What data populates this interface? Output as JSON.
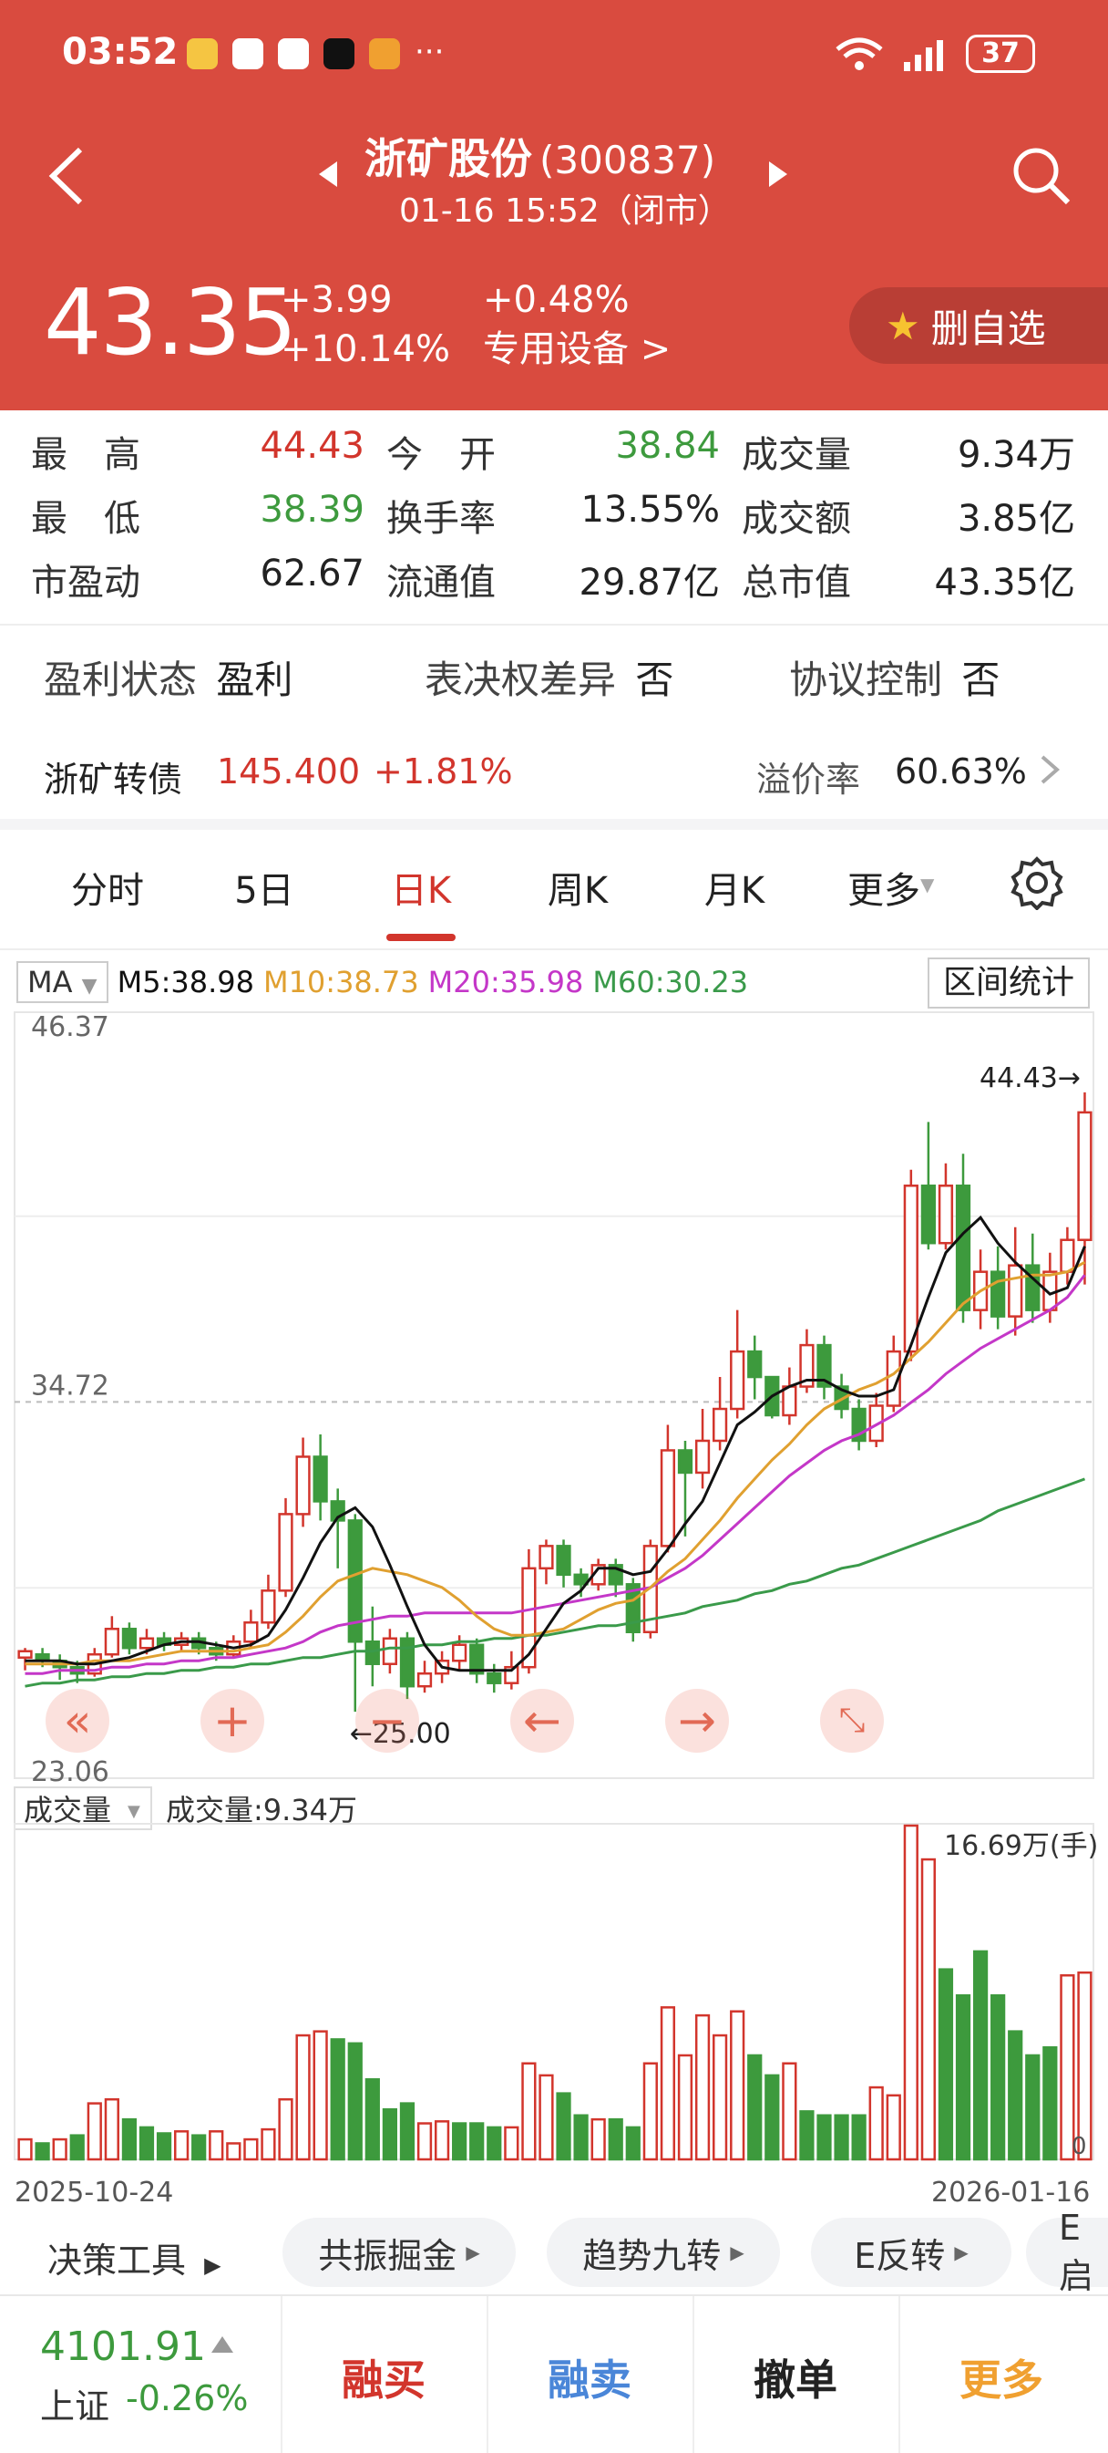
{
  "status_bar": {
    "time": "03:52",
    "dots": "···",
    "battery": "37"
  },
  "header": {
    "back_icon": "back-arrow-icon",
    "stock_name": "浙矿股份",
    "stock_code": "(300837)",
    "datetime": "01-16 15:52（闭市）",
    "price": "43.35",
    "change": "+3.99",
    "change_pct": "+10.14%",
    "other_pct": "+0.48%",
    "sector": "专用设备 >",
    "fav_button": "删自选"
  },
  "stats": [
    [
      {
        "label": "最　高",
        "value": "44.43",
        "color": "red"
      },
      {
        "label": "今　开",
        "value": "38.84",
        "color": "green"
      },
      {
        "label": "成交量",
        "value": "9.34万",
        "color": "dark"
      }
    ],
    [
      {
        "label": "最　低",
        "value": "38.39",
        "color": "green"
      },
      {
        "label": "换手率",
        "value": "13.55%",
        "color": "dark"
      },
      {
        "label": "成交额",
        "value": "3.85亿",
        "color": "dark"
      }
    ],
    [
      {
        "label": "市盈动",
        "value": "62.67",
        "color": "dark"
      },
      {
        "label": "流通值",
        "value": "29.87亿",
        "color": "dark"
      },
      {
        "label": "总市值",
        "value": "43.35亿",
        "color": "dark"
      }
    ]
  ],
  "tags": {
    "profit_label": "盈利状态",
    "profit_value": "盈利",
    "vote_label": "表决权差异",
    "vote_value": "否",
    "agree_label": "协议控制",
    "agree_value": "否"
  },
  "bond": {
    "name": "浙矿转债",
    "price": "145.400",
    "change": "+1.81%",
    "premium_label": "溢价率",
    "premium_value": "60.63%"
  },
  "tabs": [
    "分时",
    "5日",
    "日K",
    "周K",
    "月K",
    "更多"
  ],
  "active_tab": "日K",
  "ma_bar": {
    "selector": "MA",
    "m5": "M5:38.98",
    "m10": "M10:38.73",
    "m20": "M20:35.98",
    "m60": "M60:30.23",
    "stats_button": "区间统计"
  },
  "colors": {
    "up": "#d2352c",
    "down": "#3d9a3d",
    "m5": "#111111",
    "m10": "#e0a030",
    "m20": "#c437c8",
    "m60": "#3a9a4a",
    "header": "#d94b3f"
  },
  "chart_data": {
    "type": "candlestick",
    "y_top_label": "46.37",
    "y_mid_label": "34.72",
    "y_bottom_label": "23.06",
    "ylim": [
      23.06,
      46.37
    ],
    "high_marker": "44.43→",
    "low_marker": "←25.00",
    "x_start": "2025-10-24",
    "x_end": "2026-01-16",
    "candles": [
      [
        26.7,
        26.9,
        26.3,
        27.0
      ],
      [
        26.8,
        26.6,
        26.4,
        27.0
      ],
      [
        26.6,
        26.4,
        26.0,
        26.8
      ],
      [
        26.4,
        26.2,
        25.9,
        26.6
      ],
      [
        26.2,
        26.8,
        26.1,
        27.0
      ],
      [
        26.8,
        27.6,
        26.7,
        28.0
      ],
      [
        27.6,
        27.0,
        26.8,
        27.8
      ],
      [
        27.0,
        27.3,
        26.8,
        27.6
      ],
      [
        27.3,
        27.1,
        26.9,
        27.5
      ],
      [
        27.1,
        27.3,
        26.9,
        27.5
      ],
      [
        27.3,
        27.0,
        26.8,
        27.5
      ],
      [
        27.0,
        26.8,
        26.6,
        27.2
      ],
      [
        26.8,
        27.2,
        26.7,
        27.4
      ],
      [
        27.2,
        27.8,
        27.0,
        28.2
      ],
      [
        27.8,
        28.8,
        27.6,
        29.3
      ],
      [
        28.8,
        31.2,
        28.6,
        31.7
      ],
      [
        31.2,
        33.0,
        30.8,
        33.6
      ],
      [
        33.0,
        31.6,
        31.0,
        33.7
      ],
      [
        31.6,
        31.0,
        29.5,
        32.0
      ],
      [
        31.0,
        27.2,
        25.0,
        31.2
      ],
      [
        27.2,
        26.5,
        25.8,
        28.3
      ],
      [
        26.5,
        27.3,
        26.2,
        27.6
      ],
      [
        27.3,
        25.8,
        25.4,
        27.5
      ],
      [
        25.8,
        26.2,
        25.6,
        26.6
      ],
      [
        26.2,
        26.6,
        25.9,
        26.9
      ],
      [
        26.6,
        27.1,
        26.3,
        27.4
      ],
      [
        27.1,
        26.2,
        25.9,
        27.3
      ],
      [
        26.2,
        25.9,
        25.6,
        26.5
      ],
      [
        25.9,
        26.4,
        25.7,
        26.9
      ],
      [
        26.4,
        29.5,
        26.2,
        30.1
      ],
      [
        29.5,
        30.2,
        29.0,
        30.4
      ],
      [
        30.2,
        29.3,
        28.9,
        30.4
      ],
      [
        29.3,
        29.0,
        28.6,
        29.5
      ],
      [
        29.0,
        29.6,
        28.8,
        29.8
      ],
      [
        29.6,
        29.0,
        28.6,
        29.8
      ],
      [
        29.0,
        27.5,
        27.2,
        29.2
      ],
      [
        27.5,
        30.2,
        27.3,
        30.4
      ],
      [
        30.2,
        33.2,
        30.0,
        34.0
      ],
      [
        33.2,
        32.5,
        30.5,
        33.5
      ],
      [
        32.5,
        33.5,
        32.0,
        34.5
      ],
      [
        33.5,
        34.5,
        33.2,
        35.5
      ],
      [
        34.5,
        36.3,
        34.2,
        37.6
      ],
      [
        36.3,
        35.5,
        34.8,
        36.8
      ],
      [
        35.5,
        34.3,
        34.2,
        35.2
      ],
      [
        34.3,
        35.2,
        34.0,
        35.8
      ],
      [
        35.2,
        36.5,
        35.0,
        37.0
      ],
      [
        36.5,
        35.2,
        34.8,
        36.8
      ],
      [
        35.2,
        34.5,
        34.2,
        35.6
      ],
      [
        34.5,
        33.5,
        33.2,
        34.8
      ],
      [
        33.5,
        34.6,
        33.3,
        35.0
      ],
      [
        34.6,
        36.3,
        34.4,
        36.8
      ],
      [
        36.3,
        41.5,
        36.0,
        42.0
      ],
      [
        41.5,
        39.7,
        39.5,
        43.5
      ],
      [
        39.7,
        41.5,
        39.5,
        42.2
      ],
      [
        41.5,
        37.6,
        37.2,
        42.5
      ],
      [
        37.6,
        38.8,
        37.0,
        39.5
      ],
      [
        38.8,
        37.4,
        37.0,
        39.6
      ],
      [
        37.4,
        39.0,
        36.8,
        40.2
      ],
      [
        39.0,
        37.6,
        37.2,
        40.0
      ],
      [
        37.6,
        38.8,
        37.2,
        39.4
      ],
      [
        38.8,
        39.8,
        38.4,
        40.2
      ],
      [
        39.8,
        43.8,
        38.4,
        44.43
      ]
    ],
    "volume_label": "成交量",
    "volume_value": "成交量:9.34万",
    "volume_max": "16.69万(手)",
    "volume_zero": "0",
    "volumes": [
      [
        1.0,
        1
      ],
      [
        0.8,
        0
      ],
      [
        1.0,
        1
      ],
      [
        1.2,
        0
      ],
      [
        2.8,
        1
      ],
      [
        3.0,
        1
      ],
      [
        2.0,
        0
      ],
      [
        1.6,
        0
      ],
      [
        1.3,
        0
      ],
      [
        1.4,
        1
      ],
      [
        1.2,
        0
      ],
      [
        1.4,
        1
      ],
      [
        0.8,
        1
      ],
      [
        1.0,
        1
      ],
      [
        1.5,
        1
      ],
      [
        3.0,
        1
      ],
      [
        6.2,
        1
      ],
      [
        6.4,
        1
      ],
      [
        6.0,
        0
      ],
      [
        5.8,
        0
      ],
      [
        4.0,
        0
      ],
      [
        2.5,
        0
      ],
      [
        2.8,
        0
      ],
      [
        1.8,
        1
      ],
      [
        1.9,
        1
      ],
      [
        1.8,
        0
      ],
      [
        1.8,
        0
      ],
      [
        1.6,
        0
      ],
      [
        1.6,
        1
      ],
      [
        4.8,
        1
      ],
      [
        4.2,
        1
      ],
      [
        3.3,
        0
      ],
      [
        2.2,
        0
      ],
      [
        2.0,
        1
      ],
      [
        2.0,
        0
      ],
      [
        1.6,
        0
      ],
      [
        4.8,
        1
      ],
      [
        7.6,
        1
      ],
      [
        5.2,
        1
      ],
      [
        7.2,
        1
      ],
      [
        6.2,
        1
      ],
      [
        7.4,
        1
      ],
      [
        5.2,
        0
      ],
      [
        4.2,
        0
      ],
      [
        4.8,
        1
      ],
      [
        2.4,
        0
      ],
      [
        2.2,
        0
      ],
      [
        2.2,
        0
      ],
      [
        2.2,
        0
      ],
      [
        3.6,
        1
      ],
      [
        3.2,
        1
      ],
      [
        16.69,
        1
      ],
      [
        15.0,
        1
      ],
      [
        9.5,
        0
      ],
      [
        8.2,
        0
      ],
      [
        10.4,
        0
      ],
      [
        8.2,
        0
      ],
      [
        6.4,
        0
      ],
      [
        5.2,
        0
      ],
      [
        5.6,
        0
      ],
      [
        9.2,
        1
      ],
      [
        9.34,
        1
      ]
    ],
    "m5": [
      26.6,
      26.6,
      26.6,
      26.5,
      26.5,
      26.6,
      26.7,
      26.9,
      27.1,
      27.2,
      27.2,
      27.1,
      27.0,
      27.1,
      27.4,
      28.2,
      29.2,
      30.3,
      31.1,
      31.4,
      30.8,
      29.6,
      28.3,
      27.1,
      26.4,
      26.3,
      26.3,
      26.3,
      26.3,
      26.8,
      27.6,
      28.4,
      28.8,
      29.5,
      29.5,
      29.3,
      29.4,
      30.1,
      30.9,
      31.6,
      32.8,
      34.0,
      34.4,
      34.9,
      35.2,
      35.4,
      35.4,
      35.1,
      34.9,
      34.9,
      35.1,
      36.5,
      38.0,
      39.4,
      40.0,
      40.5,
      39.7,
      39.1,
      38.6,
      38.1,
      38.3,
      39.6
    ],
    "m10": [
      26.5,
      26.5,
      26.5,
      26.5,
      26.6,
      26.6,
      26.6,
      26.7,
      26.8,
      26.9,
      26.9,
      26.9,
      26.9,
      27.0,
      27.1,
      27.5,
      28.0,
      28.6,
      29.1,
      29.3,
      29.5,
      29.4,
      29.3,
      29.1,
      28.9,
      28.5,
      28.0,
      27.6,
      27.4,
      27.4,
      27.5,
      27.6,
      27.9,
      28.2,
      28.4,
      28.5,
      28.9,
      29.4,
      29.8,
      30.4,
      31.0,
      31.7,
      32.3,
      32.9,
      33.4,
      34.0,
      34.5,
      34.8,
      35.1,
      35.3,
      35.6,
      36.1,
      36.6,
      37.2,
      37.8,
      38.2,
      38.5,
      38.6,
      38.7,
      38.7,
      38.8,
      39.1
    ],
    "m20": [
      26.2,
      26.2,
      26.3,
      26.3,
      26.3,
      26.4,
      26.4,
      26.5,
      26.5,
      26.6,
      26.6,
      26.7,
      26.7,
      26.8,
      26.9,
      27.0,
      27.2,
      27.5,
      27.7,
      27.8,
      27.9,
      28.0,
      28.0,
      28.1,
      28.1,
      28.1,
      28.1,
      28.1,
      28.1,
      28.2,
      28.3,
      28.4,
      28.5,
      28.6,
      28.7,
      28.8,
      28.9,
      29.2,
      29.5,
      29.9,
      30.4,
      30.9,
      31.4,
      31.9,
      32.4,
      32.8,
      33.2,
      33.5,
      33.7,
      34.0,
      34.3,
      34.7,
      35.1,
      35.6,
      36.0,
      36.4,
      36.7,
      37.0,
      37.3,
      37.6,
      38.0,
      38.7
    ],
    "m60": [
      25.8,
      25.9,
      25.9,
      26.0,
      26.0,
      26.1,
      26.1,
      26.2,
      26.2,
      26.3,
      26.3,
      26.4,
      26.4,
      26.5,
      26.5,
      26.6,
      26.7,
      26.7,
      26.8,
      26.9,
      26.9,
      27.0,
      27.0,
      27.1,
      27.1,
      27.2,
      27.2,
      27.3,
      27.3,
      27.4,
      27.4,
      27.5,
      27.6,
      27.7,
      27.7,
      27.8,
      27.9,
      28.0,
      28.1,
      28.3,
      28.4,
      28.5,
      28.7,
      28.8,
      29.0,
      29.1,
      29.3,
      29.5,
      29.6,
      29.8,
      30.0,
      30.2,
      30.4,
      30.6,
      30.8,
      31.0,
      31.3,
      31.5,
      31.7,
      31.9,
      32.1,
      32.3
    ]
  },
  "tools": {
    "decision": "决策工具",
    "pills": [
      "共振掘金",
      "趋势九转",
      "E反转",
      "E启"
    ]
  },
  "bottom": {
    "index_value": "4101.91",
    "index_name": "上证",
    "index_change": "-0.26%",
    "buy": "融买",
    "sell": "融卖",
    "cancel": "撤单",
    "more": "更多"
  }
}
